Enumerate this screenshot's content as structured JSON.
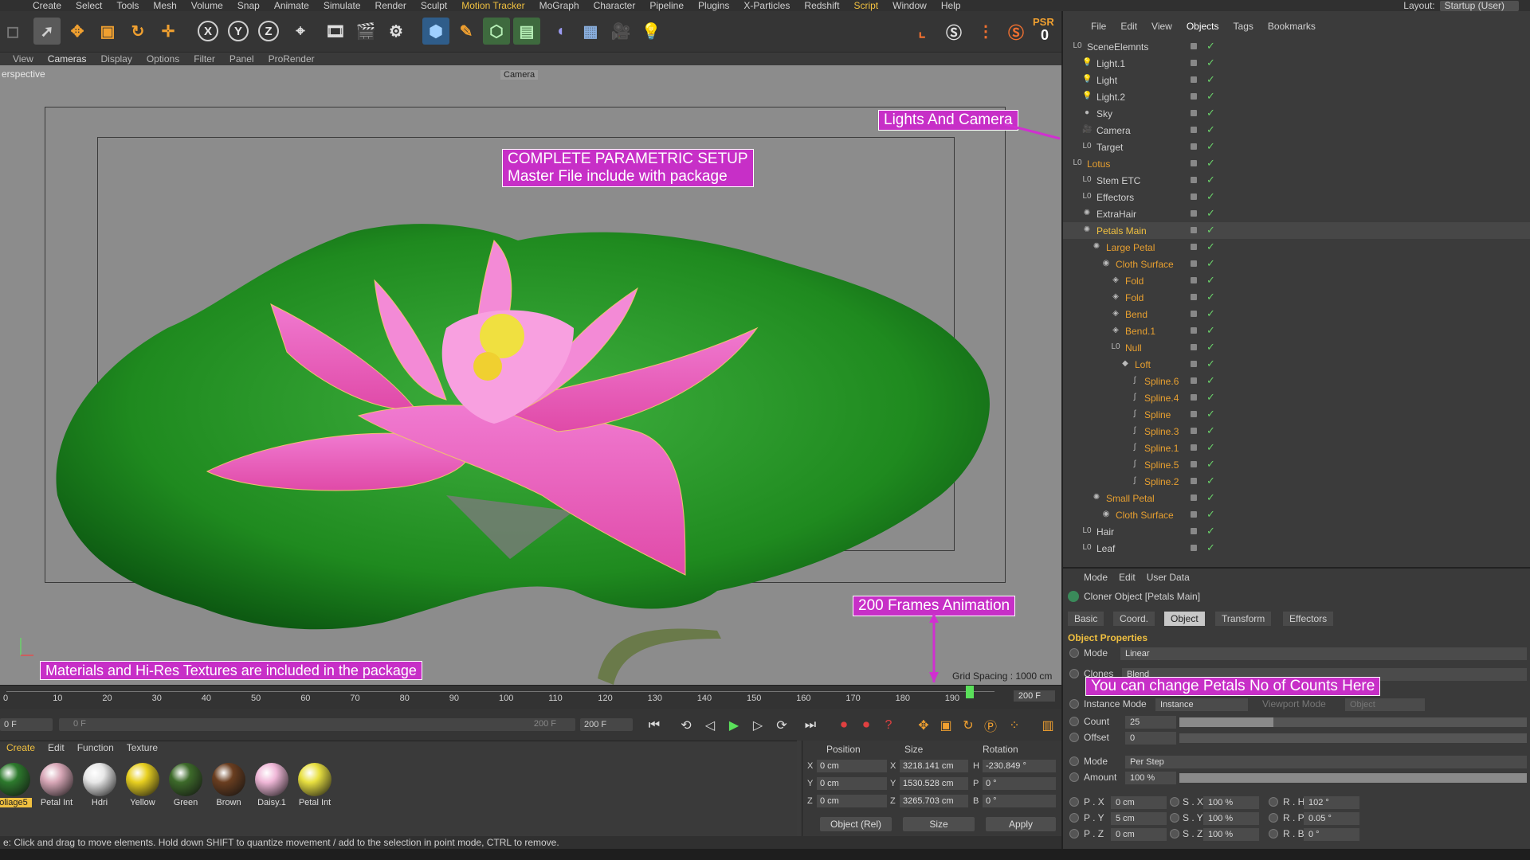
{
  "menubar": [
    "Create",
    "Select",
    "Tools",
    "Mesh",
    "Volume",
    "Snap",
    "Animate",
    "Simulate",
    "Render",
    "Sculpt",
    "Motion Tracker",
    "MoGraph",
    "Character",
    "Pipeline",
    "Plugins",
    "X-Particles",
    "Redshift",
    "Script",
    "Window",
    "Help"
  ],
  "layout": {
    "label": "Layout:",
    "value": "Startup (User)"
  },
  "toolbar": {
    "psr_label": "PSR",
    "psr_value": "0",
    "icons": [
      "move-cursor",
      "move",
      "scale",
      "rotate",
      "add",
      "x-axis",
      "y-axis",
      "z-axis",
      "world-coord",
      "render-view",
      "render-picture",
      "render-settings",
      "cube",
      "pen",
      "subdivision",
      "generator",
      "deformer",
      "floor",
      "camera",
      "light"
    ]
  },
  "viewport_menu": [
    "View",
    "Cameras",
    "Display",
    "Options",
    "Filter",
    "Panel",
    "ProRender"
  ],
  "viewport": {
    "label": "erspective",
    "camera_label": "Camera",
    "grid_spacing": "Grid Spacing : 1000 cm",
    "annotations": {
      "setup_line1": "COMPLETE PARAMETRIC SETUP",
      "setup_line2": "Master File include with package",
      "lights": "Lights And Camera",
      "frames": "200 Frames Animation",
      "materials": "Materials and Hi-Res Textures are included in the package",
      "petals": "You can change Petals No of Counts Here"
    }
  },
  "timeline": {
    "ticks": [
      "0",
      "10",
      "20",
      "30",
      "40",
      "50",
      "60",
      "70",
      "80",
      "90",
      "100",
      "110",
      "120",
      "130",
      "140",
      "150",
      "160",
      "170",
      "180",
      "190"
    ],
    "end": "200 F",
    "current_frame": 195,
    "max_frame": 200
  },
  "transport": {
    "start": "0 F",
    "range_start": "0 F",
    "range_end": "200 F",
    "end": "200 F"
  },
  "materials": {
    "menu": [
      "Create",
      "Edit",
      "Function",
      "Texture"
    ],
    "items": [
      {
        "name": "oliage5",
        "color": "#2d7a2d"
      },
      {
        "name": "Petal Int",
        "color": "#d9a8b8"
      },
      {
        "name": "Hdri",
        "color": "#e8e8e8"
      },
      {
        "name": "Yellow",
        "color": "#e8d020"
      },
      {
        "name": "Green",
        "color": "#3d6a2a"
      },
      {
        "name": "Brown",
        "color": "#6a3e20"
      },
      {
        "name": "Daisy.1",
        "color": "#f0b8d8"
      },
      {
        "name": "Petal Int",
        "color": "#e8e040"
      }
    ]
  },
  "coords": {
    "headers": [
      "Position",
      "Size",
      "Rotation"
    ],
    "rows": [
      {
        "axis": "X",
        "pos": "0 cm",
        "size_axis": "X",
        "size": "3218.141 cm",
        "rot_axis": "H",
        "rot": "-230.849 °"
      },
      {
        "axis": "Y",
        "pos": "0 cm",
        "size_axis": "Y",
        "size": "1530.528 cm",
        "rot_axis": "P",
        "rot": "0 °"
      },
      {
        "axis": "Z",
        "pos": "0 cm",
        "size_axis": "Z",
        "size": "3265.703 cm",
        "rot_axis": "B",
        "rot": "0 °"
      }
    ],
    "mode": "Object (Rel)",
    "size_mode": "Size",
    "apply": "Apply"
  },
  "status": "e: Click and drag to move elements. Hold down SHIFT to quantize movement / add to the selection in point mode, CTRL to remove.",
  "object_manager": {
    "menu": [
      "File",
      "Edit",
      "View",
      "Objects",
      "Tags",
      "Bookmarks"
    ],
    "items": [
      {
        "name": "SceneElemnts",
        "depth": 0,
        "color": "#d0d0d0",
        "icon": "null"
      },
      {
        "name": "Light.1",
        "depth": 1,
        "color": "#d0d0d0",
        "icon": "light"
      },
      {
        "name": "Light",
        "depth": 1,
        "color": "#d0d0d0",
        "icon": "light"
      },
      {
        "name": "Light.2",
        "depth": 1,
        "color": "#d0d0d0",
        "icon": "light"
      },
      {
        "name": "Sky",
        "depth": 1,
        "color": "#d0d0d0",
        "icon": "sky"
      },
      {
        "name": "Camera",
        "depth": 1,
        "color": "#d0d0d0",
        "icon": "camera"
      },
      {
        "name": "Target",
        "depth": 1,
        "color": "#d0d0d0",
        "icon": "null"
      },
      {
        "name": "Lotus",
        "depth": 0,
        "color": "#e8a030",
        "icon": "null"
      },
      {
        "name": "Stem ETC",
        "depth": 1,
        "color": "#d0d0d0",
        "icon": "null"
      },
      {
        "name": "Effectors",
        "depth": 1,
        "color": "#d0d0d0",
        "icon": "null"
      },
      {
        "name": "ExtraHair",
        "depth": 1,
        "color": "#d0d0d0",
        "icon": "cloner"
      },
      {
        "name": "Petals Main",
        "depth": 1,
        "color": "#f0c040",
        "icon": "cloner"
      },
      {
        "name": "Large Petal",
        "depth": 2,
        "color": "#e8a030",
        "icon": "cloner"
      },
      {
        "name": "Cloth Surface",
        "depth": 3,
        "color": "#e8a030",
        "icon": "cloth"
      },
      {
        "name": "Fold",
        "depth": 4,
        "color": "#e8a030",
        "icon": "deformer"
      },
      {
        "name": "Fold",
        "depth": 4,
        "color": "#e8a030",
        "icon": "deformer"
      },
      {
        "name": "Bend",
        "depth": 4,
        "color": "#e8a030",
        "icon": "deformer"
      },
      {
        "name": "Bend.1",
        "depth": 4,
        "color": "#e8a030",
        "icon": "deformer"
      },
      {
        "name": "Null",
        "depth": 4,
        "color": "#e8a030",
        "icon": "null"
      },
      {
        "name": "Loft",
        "depth": 5,
        "color": "#e8a030",
        "icon": "loft"
      },
      {
        "name": "Spline.6",
        "depth": 6,
        "color": "#e8a030",
        "icon": "spline"
      },
      {
        "name": "Spline.4",
        "depth": 6,
        "color": "#e8a030",
        "icon": "spline"
      },
      {
        "name": "Spline",
        "depth": 6,
        "color": "#e8a030",
        "icon": "spline"
      },
      {
        "name": "Spline.3",
        "depth": 6,
        "color": "#e8a030",
        "icon": "spline"
      },
      {
        "name": "Spline.1",
        "depth": 6,
        "color": "#e8a030",
        "icon": "spline"
      },
      {
        "name": "Spline.5",
        "depth": 6,
        "color": "#e8a030",
        "icon": "spline"
      },
      {
        "name": "Spline.2",
        "depth": 6,
        "color": "#e8a030",
        "icon": "spline"
      },
      {
        "name": "Small Petal",
        "depth": 2,
        "color": "#e8a030",
        "icon": "cloner"
      },
      {
        "name": "Cloth Surface",
        "depth": 3,
        "color": "#e8a030",
        "icon": "cloth"
      },
      {
        "name": "Hair",
        "depth": 1,
        "color": "#d0d0d0",
        "icon": "null"
      },
      {
        "name": "Leaf",
        "depth": 1,
        "color": "#d0d0d0",
        "icon": "null"
      }
    ]
  },
  "attributes": {
    "menu": [
      "Mode",
      "Edit",
      "User Data"
    ],
    "title": "Cloner Object [Petals Main]",
    "tabs": [
      "Basic",
      "Coord.",
      "Object",
      "Transform",
      "Effectors"
    ],
    "active_tab": "Object",
    "section": "Object Properties",
    "mode_label": "Mode",
    "mode_value": "Linear",
    "clones_label": "Clones",
    "clones_value": "Blend",
    "instance_mode_label": "Instance Mode",
    "instance_mode_value": "Instance",
    "viewport_mode_label": "Viewport Mode",
    "viewport_mode_value": "Object",
    "count_label": "Count",
    "count_value": "25",
    "offset_label": "Offset",
    "offset_value": "0",
    "mode2_label": "Mode",
    "mode2_value": "Per Step",
    "amount_label": "Amount",
    "amount_value": "100 %",
    "px_label": "P . X",
    "px": "0 cm",
    "sx_label": "S . X",
    "sx": "100 %",
    "rh_label": "R . H",
    "rh": "102 °",
    "py_label": "P . Y",
    "py": "5 cm",
    "sy_label": "S . Y",
    "sy": "100 %",
    "rp_label": "R . P",
    "rp": "0.05 °",
    "pz_label": "P . Z",
    "pz": "0 cm",
    "sz_label": "S . Z",
    "sz": "100 %",
    "rb_label": "R . B",
    "rb": "0 °"
  },
  "colors": {
    "annotation": "#c72fc7",
    "accent": "#f0c040",
    "lotus_pink": "#e85ab8",
    "leaf_green": "#2a9a2a"
  }
}
